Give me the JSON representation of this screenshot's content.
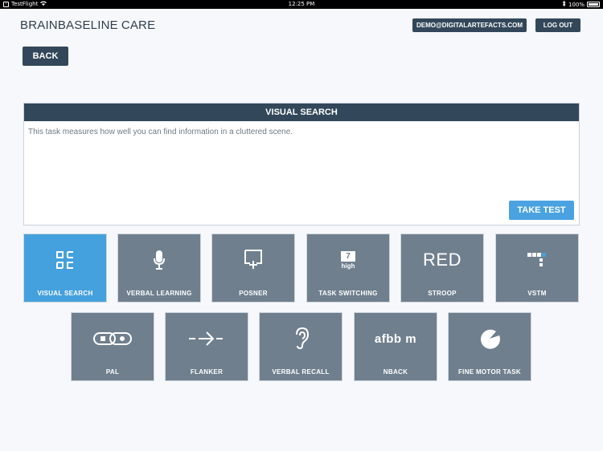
{
  "status_bar": {
    "app": "TestFlight",
    "time": "12:25 PM",
    "battery": "100%"
  },
  "brand": {
    "part1": "BRAINBASELINE",
    "part2": "CARE"
  },
  "header": {
    "email": "DEMO@DIGITALARTEFACTS.COM",
    "logout": "LOG OUT"
  },
  "back_label": "BACK",
  "panel": {
    "title": "VISUAL SEARCH",
    "description": "This task measures how well you can find information in a cluttered scene.",
    "take_test": "TAKE TEST"
  },
  "tasks": [
    {
      "label": "VISUAL SEARCH",
      "icon": "visual-search-icon",
      "selected": true
    },
    {
      "label": "VERBAL LEARNING",
      "icon": "microphone-icon"
    },
    {
      "label": "POSNER",
      "icon": "posner-icon"
    },
    {
      "label": "TASK SWITCHING",
      "icon": "task-switching-icon",
      "icon_text_top": "7",
      "icon_text_bottom": "high"
    },
    {
      "label": "STROOP",
      "icon": "stroop-icon",
      "icon_text": "RED"
    },
    {
      "label": "VSTM",
      "icon": "vstm-icon"
    },
    {
      "label": "PAL",
      "icon": "pal-icon"
    },
    {
      "label": "FLANKER",
      "icon": "flanker-icon"
    },
    {
      "label": "VERBAL RECALL",
      "icon": "ear-icon"
    },
    {
      "label": "NBACK",
      "icon": "nback-icon",
      "icon_text": "afbb m"
    },
    {
      "label": "FINE MOTOR TASK",
      "icon": "fine-motor-icon"
    }
  ],
  "colors": {
    "dark": "#324759",
    "accent": "#45a1dd",
    "tile": "#6f7f8e"
  }
}
